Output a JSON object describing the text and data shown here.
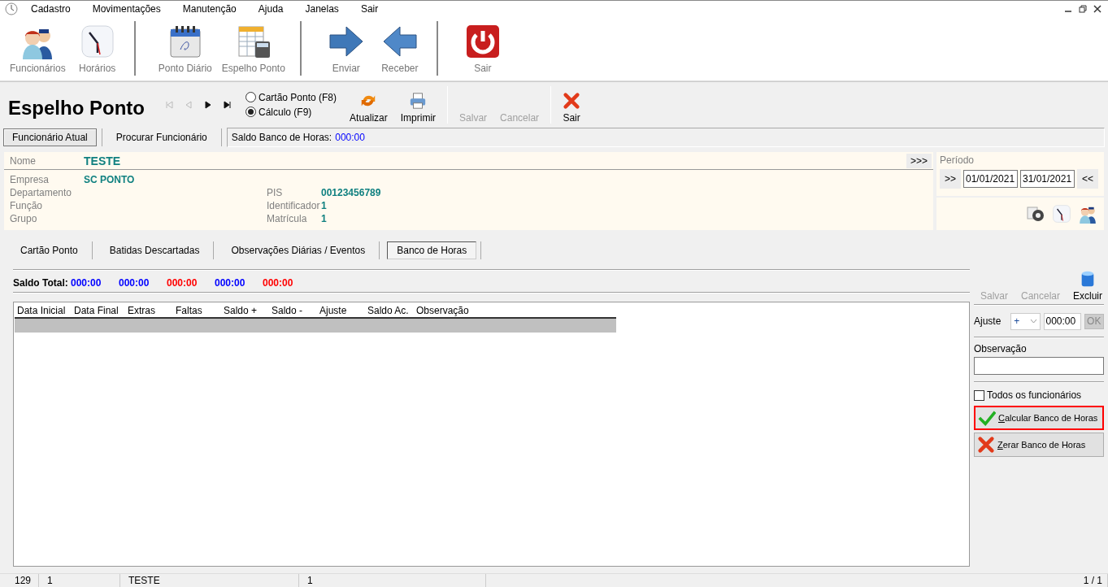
{
  "menu": {
    "items": [
      "Cadastro",
      "Movimentações",
      "Manutenção",
      "Ajuda",
      "Janelas",
      "Sair"
    ]
  },
  "toolbar": {
    "groups": [
      [
        {
          "label": "Funcionários",
          "kind": "people"
        },
        {
          "label": "Horários",
          "kind": "clock"
        }
      ],
      [
        {
          "label": "Ponto Diário",
          "kind": "calendar"
        },
        {
          "label": "Espelho Ponto",
          "kind": "sheet"
        }
      ],
      [
        {
          "label": "Enviar",
          "kind": "arrow-right"
        },
        {
          "label": "Receber",
          "kind": "arrow-left"
        }
      ],
      [
        {
          "label": "Sair",
          "kind": "power"
        }
      ]
    ]
  },
  "header": {
    "title": "Espelho Ponto",
    "nav": [
      {
        "kind": "first",
        "disabled": true
      },
      {
        "kind": "prev",
        "disabled": true
      },
      {
        "kind": "next",
        "disabled": false
      },
      {
        "kind": "last",
        "disabled": false
      }
    ],
    "modes": [
      {
        "label": "Cartão Ponto (F8)",
        "selected": false
      },
      {
        "label": "Cálculo (F9)",
        "selected": true
      }
    ],
    "actions": [
      {
        "label": "Atualizar",
        "kind": "refresh",
        "disabled": false
      },
      {
        "label": "Imprimir",
        "kind": "printer",
        "disabled": false
      },
      {
        "label": "Salvar",
        "kind": "none",
        "disabled": true
      },
      {
        "label": "Cancelar",
        "kind": "none",
        "disabled": true
      },
      {
        "label": "Sair",
        "kind": "close",
        "disabled": false
      }
    ]
  },
  "subtabs": {
    "items": [
      {
        "label": "Funcionário Atual",
        "selected": true
      },
      {
        "label": "Procurar Funcionário",
        "selected": false
      }
    ],
    "balance_label": "Saldo Banco de Horas:",
    "balance_value": "000:00"
  },
  "employee": {
    "name_label": "Nome",
    "name": "TESTE",
    "expand": ">>>",
    "rows": [
      {
        "left": {
          "label": "Empresa",
          "value": "SC PONTO"
        }
      },
      {
        "left": {
          "label": "Departamento"
        },
        "right": {
          "label": "PIS",
          "value": "00123456789"
        }
      },
      {
        "left": {
          "label": "Função"
        },
        "right": {
          "label": "Identificador",
          "value": "1"
        }
      },
      {
        "left": {
          "label": "Grupo"
        },
        "right": {
          "label": "Matrícula",
          "value": "1"
        }
      }
    ]
  },
  "period": {
    "label": "Período",
    "forward": ">>",
    "start": "01/01/2021",
    "end": "31/01/2021",
    "back": "<<"
  },
  "quick_icons": [
    {
      "kind": "gear"
    },
    {
      "kind": "clock"
    },
    {
      "kind": "people"
    }
  ],
  "tabs": [
    {
      "label": "Cartão Ponto",
      "selected": false
    },
    {
      "label": "Batidas Descartadas",
      "selected": false
    },
    {
      "label": "Observações Diárias / Eventos",
      "selected": false
    },
    {
      "label": "Banco de Horas",
      "selected": true
    }
  ],
  "saldo_total": {
    "label": "Saldo Total:",
    "values": [
      {
        "text": "000:00",
        "color": "#0000ff"
      },
      {
        "text": "000:00",
        "color": "#0000ff"
      },
      {
        "text": "000:00",
        "color": "#ff0000"
      },
      {
        "text": "000:00",
        "color": "#0000ff"
      },
      {
        "text": "000:00",
        "color": "#ff0000"
      }
    ]
  },
  "table": {
    "columns": [
      "Data Inicial",
      "Data Final",
      "Extras",
      "Faltas",
      "Saldo +",
      "Saldo -",
      "Ajuste",
      "Saldo Ac.",
      "Observação"
    ]
  },
  "side": {
    "actions": [
      {
        "label": "Salvar",
        "disabled": true
      },
      {
        "label": "Cancelar",
        "disabled": true
      },
      {
        "label": "Excluir",
        "disabled": false
      }
    ],
    "ajuste_label": "Ajuste",
    "sign": "+",
    "time": "000:00",
    "ok": {
      "label": "OK",
      "disabled": true
    },
    "observacao_label": "Observação",
    "all_employees": {
      "label": "Todos os funcionários",
      "checked": false
    },
    "buttons": [
      {
        "label": "Calcular Banco de Horas",
        "kind": "check",
        "highlighted": true
      },
      {
        "label": "Zerar Banco de Horas",
        "kind": "cross",
        "highlighted": false
      }
    ]
  },
  "status_bar": [
    "129",
    "1",
    "TESTE",
    "1",
    "1 / 1"
  ]
}
